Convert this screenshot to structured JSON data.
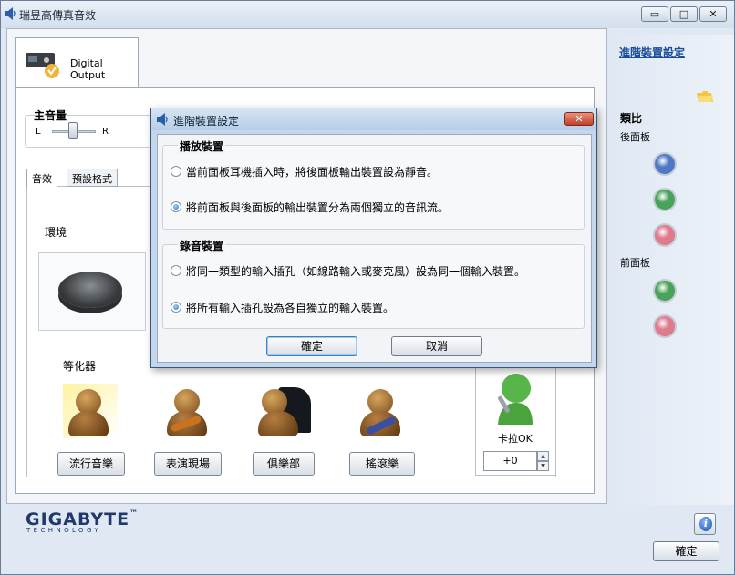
{
  "window": {
    "title": "瑞昱高傳真音效",
    "minimize": "▭",
    "maximize": "□",
    "close": "✕"
  },
  "device_tab": {
    "label": "Digital Output"
  },
  "volume": {
    "title": "主音量",
    "left": "L",
    "right": "R"
  },
  "subtabs": [
    {
      "label": "音效"
    },
    {
      "label": "預設格式"
    }
  ],
  "environment": {
    "label": "環境"
  },
  "equalizer": {
    "label": "等化器",
    "presets": [
      {
        "label": "流行音樂"
      },
      {
        "label": "表演現場"
      },
      {
        "label": "俱樂部"
      },
      {
        "label": "搖滾樂"
      }
    ]
  },
  "karaoke": {
    "label": "卡拉OK",
    "value": "+0"
  },
  "right_panel": {
    "advanced_link": "進階裝置設定",
    "analog": "類比",
    "back_panel": "後面板",
    "front_panel": "前面板",
    "jack_colors": {
      "blue": "#4f79c7",
      "green": "#4aa35a",
      "pink": "#e07a8d"
    }
  },
  "footer": {
    "brand": "GIGABYTE",
    "brand_tm": "™",
    "brand_sub": "TECHNOLOGY",
    "ok": "確定",
    "info_glyph": "i"
  },
  "dialog": {
    "title": "進階裝置設定",
    "close": "✕",
    "playback": {
      "title": "播放裝置",
      "options": [
        {
          "label": "當前面板耳機插入時，將後面板輸出裝置設為靜音。",
          "selected": false
        },
        {
          "label": "將前面板與後面板的輸出裝置分為兩個獨立的音訊流。",
          "selected": true
        }
      ]
    },
    "recording": {
      "title": "錄音裝置",
      "options": [
        {
          "label": "將同一類型的輸入插孔（如線路輸入或麥克風）設為同一個輸入裝置。",
          "selected": false
        },
        {
          "label": "將所有輸入插孔設為各自獨立的輸入裝置。",
          "selected": true
        }
      ]
    },
    "ok": "確定",
    "cancel": "取消"
  }
}
